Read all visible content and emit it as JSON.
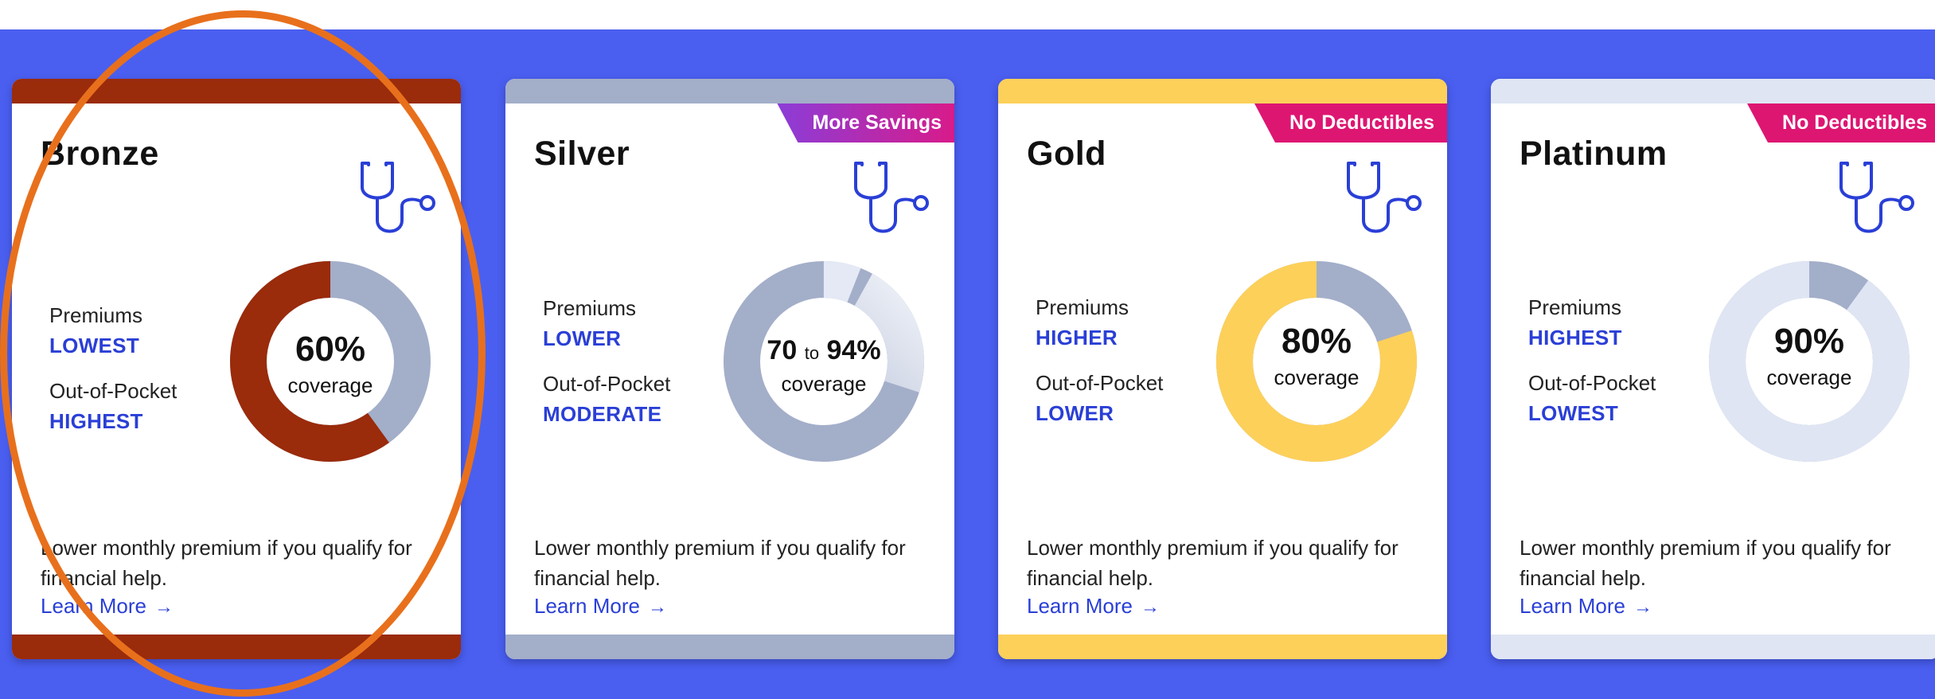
{
  "plans": [
    {
      "name": "Bronze",
      "badge": "",
      "accent": "#9a2b0b",
      "track": "#a3aec9",
      "coverage_fraction": 0.6,
      "coverage_label": "60%",
      "coverage_low": "",
      "coverage_to": "",
      "coverage_word": "coverage",
      "premiums_label": "Premiums",
      "premiums_value": "LOWEST",
      "oop_label": "Out-of-Pocket",
      "oop_value": "HIGHEST",
      "description": "Lower monthly premium if you qualify for financial help.",
      "learn_more": "Learn More",
      "arrow": "→",
      "icon": "stethoscope-icon"
    },
    {
      "name": "Silver",
      "badge": "More Savings",
      "accent": "#a3aec9",
      "track": "#dfe5f3",
      "coverage_low": "70",
      "coverage_to": "to",
      "coverage_label": "94%",
      "coverage_word": "coverage",
      "premiums_label": "Premiums",
      "premiums_value": "LOWER",
      "oop_label": "Out-of-Pocket",
      "oop_value": "MODERATE",
      "description": "Lower monthly premium if you qualify for financial help.",
      "learn_more": "Learn More",
      "arrow": "→",
      "icon": "stethoscope-icon"
    },
    {
      "name": "Gold",
      "badge": "No Deductibles",
      "accent": "#fdd05a",
      "track": "#a3aec9",
      "coverage_fraction": 0.8,
      "coverage_label": "80%",
      "coverage_low": "",
      "coverage_to": "",
      "coverage_word": "coverage",
      "premiums_label": "Premiums",
      "premiums_value": "HIGHER",
      "oop_label": "Out-of-Pocket",
      "oop_value": "LOWER",
      "description": "Lower monthly premium if you qualify for financial help.",
      "learn_more": "Learn More",
      "arrow": "→",
      "icon": "stethoscope-icon"
    },
    {
      "name": "Platinum",
      "badge": "No Deductibles",
      "accent": "#dfe5f3",
      "track": "#a3aec9",
      "coverage_fraction": 0.9,
      "coverage_label": "90%",
      "coverage_low": "",
      "coverage_to": "",
      "coverage_word": "coverage",
      "premiums_label": "Premiums",
      "premiums_value": "HIGHEST",
      "oop_label": "Out-of-Pocket",
      "oop_value": "LOWEST",
      "description": "Lower monthly premium if you qualify for financial help.",
      "learn_more": "Learn More",
      "arrow": "→",
      "icon": "stethoscope-icon"
    }
  ],
  "colors": {
    "band": "#4a5ff0",
    "link": "#2a3fd6",
    "highlight": "#e8701c"
  }
}
